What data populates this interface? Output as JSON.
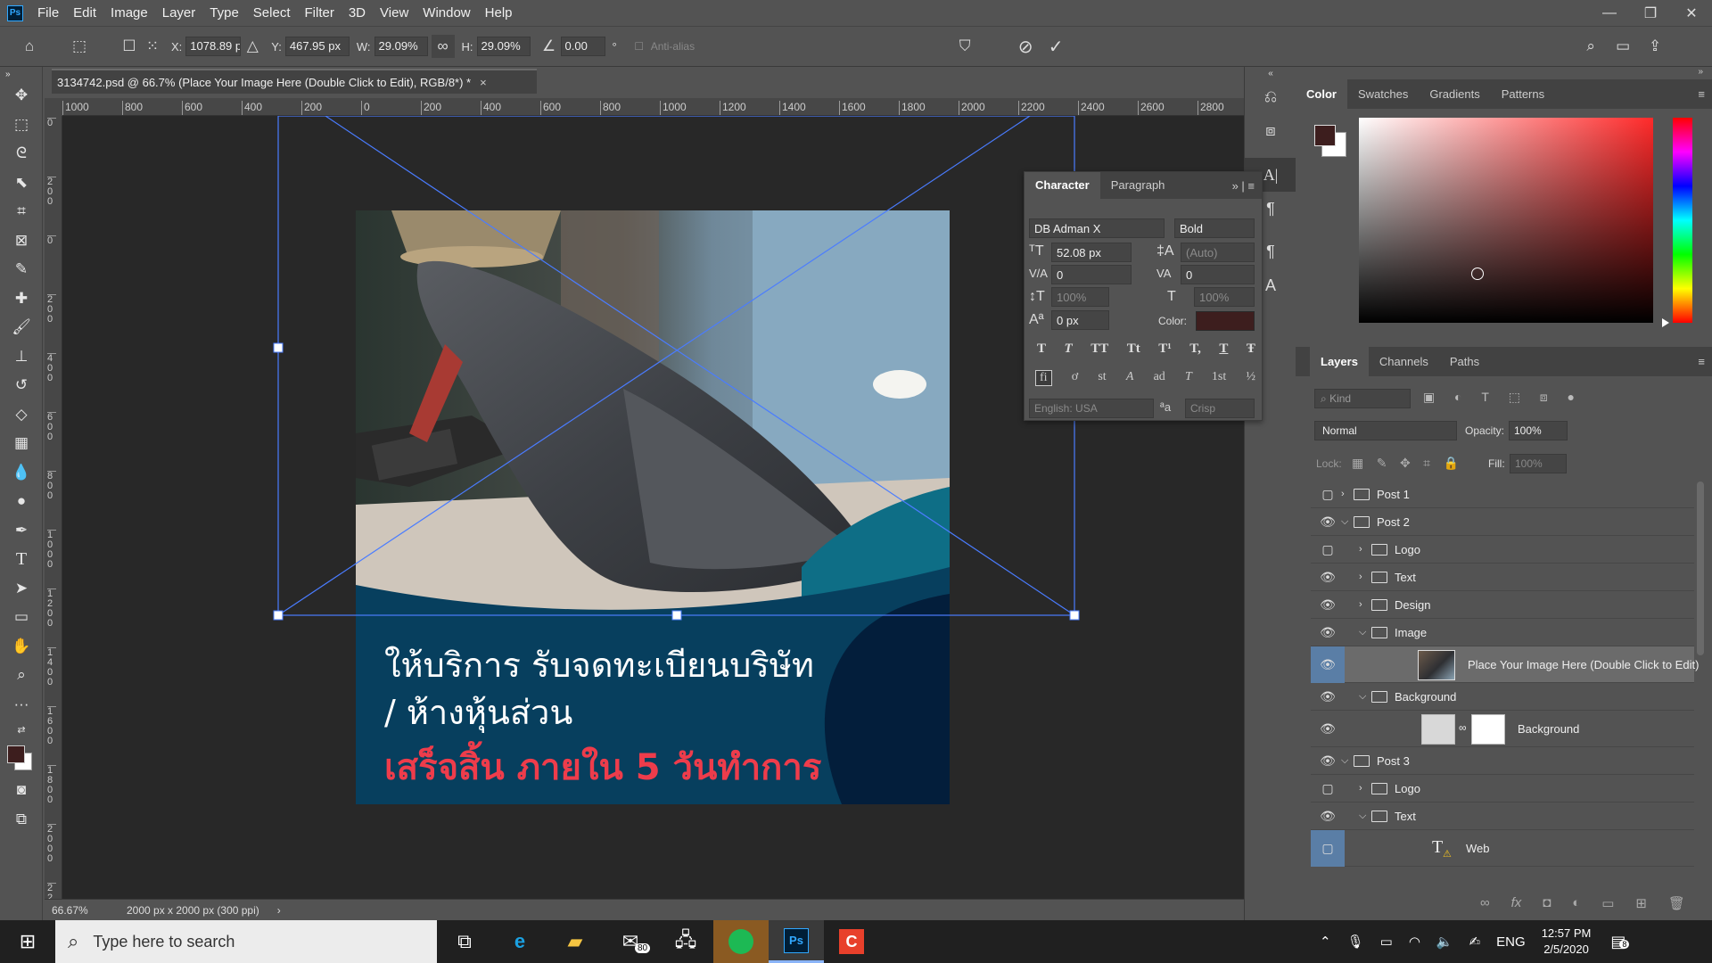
{
  "menubar": {
    "app_icon": "Ps",
    "items": [
      "File",
      "Edit",
      "Image",
      "Layer",
      "Type",
      "Select",
      "Filter",
      "3D",
      "View",
      "Window",
      "Help"
    ],
    "window_controls": [
      "minimize-icon",
      "restore-icon",
      "close-icon"
    ]
  },
  "options": {
    "x_label": "X:",
    "x_value": "1078.89 p",
    "y_label": "Y:",
    "y_value": "467.95 px",
    "w_label": "W:",
    "w_value": "29.09%",
    "h_label": "H:",
    "h_value": "29.09%",
    "angle_value": "0.00",
    "angle_unit": "°",
    "antialias_label": "Anti-alias"
  },
  "document": {
    "tab_title": "3134742.psd @ 66.7% (Place Your Image Here (Double Click to Edit), RGB/8*) *",
    "ruler_h_labels": [
      "1000",
      "800",
      "600",
      "400",
      "200",
      "0",
      "200",
      "400",
      "600",
      "800",
      "1000",
      "1200",
      "1400",
      "1600",
      "1800",
      "2000",
      "2200",
      "2400",
      "2600",
      "2800"
    ],
    "ruler_v_labels": [
      "0",
      "2 0 0",
      "0",
      "2 0 0",
      "4 0 0",
      "6 0 0",
      "8 0 0",
      "1 0 0 0",
      "1 2 0 0",
      "1 4 0 0",
      "1 6 0 0",
      "1 8 0 0",
      "2 0 0 0",
      "2 2 0 0"
    ],
    "zoom": "66.67%",
    "doc_info": "2000 px x 2000 px (300 ppi)"
  },
  "artwork": {
    "line1": "ให้บริการ รับจดทะเบียนบริษัท",
    "line2": "/ ห้างหุ้นส่วน",
    "line3": "เสร็จสิ้น ภายใน 5 วันทำการ"
  },
  "character": {
    "tabs": [
      "Character",
      "Paragraph"
    ],
    "font_family": "DB Adman X",
    "font_style": "Bold",
    "size": "52.08 px",
    "leading": "(Auto)",
    "kerning": "0",
    "tracking": "0",
    "vscale": "100%",
    "hscale": "100%",
    "baseline": "0 px",
    "color_label": "Color:",
    "language": "English: USA",
    "aa_label": "a",
    "antialias": "Crisp",
    "style_buttons": [
      "T",
      "T",
      "TT",
      "Tt",
      "T¹",
      "T,",
      "T",
      "Ŧ"
    ],
    "opentype_buttons": [
      "fi",
      "ơ",
      "st",
      "A",
      "ad",
      "T",
      "1st",
      "½"
    ]
  },
  "color_panel": {
    "tabs": [
      "Color",
      "Swatches",
      "Gradients",
      "Patterns"
    ]
  },
  "layers_panel": {
    "tabs": [
      "Layers",
      "Channels",
      "Paths"
    ],
    "kind": "Kind",
    "blend_mode": "Normal",
    "opacity_label": "Opacity:",
    "opacity": "100%",
    "lock_label": "Lock:",
    "fill_label": "Fill:",
    "fill": "100%",
    "layers": [
      {
        "name": "Post 1",
        "visible": false,
        "type": "group",
        "indent": 0,
        "expanded": false
      },
      {
        "name": "Post 2",
        "visible": true,
        "type": "group",
        "indent": 0,
        "expanded": true
      },
      {
        "name": "Logo",
        "visible": false,
        "type": "group",
        "indent": 1,
        "expanded": false
      },
      {
        "name": "Text",
        "visible": true,
        "type": "group",
        "indent": 1,
        "expanded": false
      },
      {
        "name": "Design",
        "visible": true,
        "type": "group",
        "indent": 1,
        "expanded": false
      },
      {
        "name": "Image",
        "visible": true,
        "type": "group",
        "indent": 1,
        "expanded": true
      },
      {
        "name": "Place Your Image Here (Double Click to Edit)",
        "visible": true,
        "type": "smart",
        "indent": 2,
        "selected": true
      },
      {
        "name": "Background",
        "visible": true,
        "type": "group",
        "indent": 1,
        "expanded": true
      },
      {
        "name": "Background",
        "visible": true,
        "type": "masked",
        "indent": 2
      },
      {
        "name": "Post 3",
        "visible": true,
        "type": "group",
        "indent": 0,
        "expanded": true
      },
      {
        "name": "Logo",
        "visible": false,
        "type": "group",
        "indent": 1,
        "expanded": false
      },
      {
        "name": "Text",
        "visible": true,
        "type": "group",
        "indent": 1,
        "expanded": true
      },
      {
        "name": "Web",
        "visible": false,
        "type": "text",
        "indent": 2
      }
    ]
  },
  "taskbar": {
    "search_placeholder": "Type here to search",
    "mail_badge": "80",
    "language": "ENG",
    "time": "12:57 PM",
    "date": "2/5/2020",
    "notification_count": "8"
  }
}
